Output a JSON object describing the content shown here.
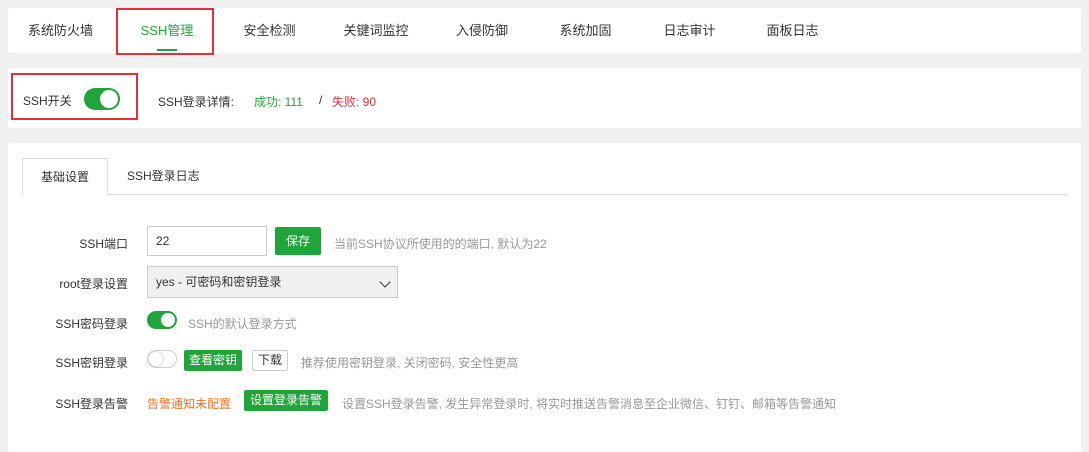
{
  "topnav": {
    "tabs": [
      {
        "label": "系统防火墙",
        "active": false
      },
      {
        "label": "SSH管理",
        "active": true
      },
      {
        "label": "安全检测",
        "active": false
      },
      {
        "label": "关键词监控",
        "active": false
      },
      {
        "label": "入侵防御",
        "active": false
      },
      {
        "label": "系统加固",
        "active": false
      },
      {
        "label": "日志审计",
        "active": false
      },
      {
        "label": "面板日志",
        "active": false
      }
    ]
  },
  "switchbar": {
    "ssh_switch_label": "SSH开关",
    "ssh_switch_on": true,
    "login_detail_label": "SSH登录详情:",
    "success_text": "成功: 111",
    "separator": "/",
    "fail_text": "失败: 90"
  },
  "subtabs": [
    {
      "label": "基础设置",
      "active": true
    },
    {
      "label": "SSH登录日志",
      "active": false
    }
  ],
  "settings": {
    "port": {
      "label": "SSH端口",
      "value": "22",
      "save_label": "保存",
      "hint": "当前SSH协议所使用的的端口, 默认为22"
    },
    "root_login": {
      "label": "root登录设置",
      "selected": "yes - 可密码和密钥登录"
    },
    "password_login": {
      "label": "SSH密码登录",
      "enabled": true,
      "hint": "SSH的默认登录方式"
    },
    "key_login": {
      "label": "SSH密钥登录",
      "enabled": false,
      "view_key_label": "查看密钥",
      "download_label": "下载",
      "hint": "推荐使用密钥登录, 关闭密码, 安全性更高"
    },
    "login_alert": {
      "label": "SSH登录告警",
      "status_link": "告警通知未配置",
      "setup_label": "设置登录告警",
      "hint": "设置SSH登录告警, 发生异常登录时, 将实时推送告警消息至企业微信、钉钉、邮箱等告警通知"
    }
  },
  "colors": {
    "accent": "#20a53a",
    "fail": "#e0303a",
    "highlight_box": "#e0303a",
    "warning_link": "#f0731c"
  }
}
